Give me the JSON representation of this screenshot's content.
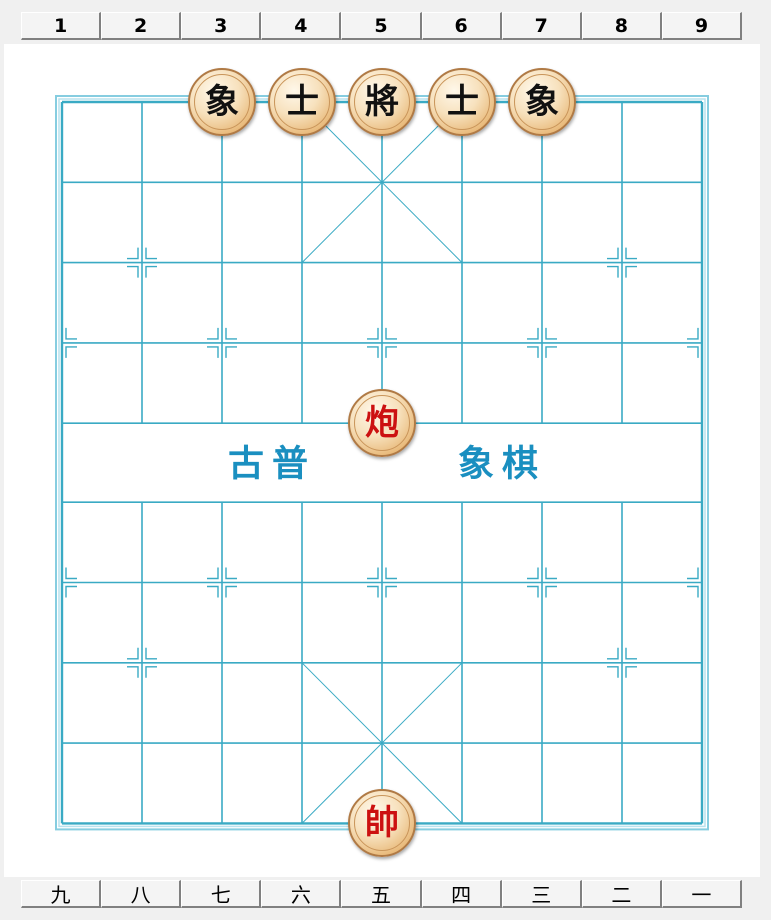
{
  "top_files": [
    "1",
    "2",
    "3",
    "4",
    "5",
    "6",
    "7",
    "8",
    "9"
  ],
  "bottom_files": [
    "九",
    "八",
    "七",
    "六",
    "五",
    "四",
    "三",
    "二",
    "一"
  ],
  "river": {
    "left_text": "古普",
    "right_text": "象棋"
  },
  "colors": {
    "grid_line": "#3aaac4",
    "river_text": "#1a8fc0",
    "red_piece_text": "#cc1111",
    "black_piece_text": "#111111"
  },
  "pieces": [
    {
      "name": "black-elephant-left",
      "label": "象",
      "side": "black",
      "file": 3,
      "rank": 0
    },
    {
      "name": "black-advisor-left",
      "label": "士",
      "side": "black",
      "file": 4,
      "rank": 0
    },
    {
      "name": "black-general",
      "label": "將",
      "side": "black",
      "file": 5,
      "rank": 0
    },
    {
      "name": "black-advisor-right",
      "label": "士",
      "side": "black",
      "file": 6,
      "rank": 0
    },
    {
      "name": "black-elephant-right",
      "label": "象",
      "side": "black",
      "file": 7,
      "rank": 0
    },
    {
      "name": "red-cannon",
      "label": "炮",
      "side": "red",
      "file": 5,
      "rank": 4
    },
    {
      "name": "red-marshal",
      "label": "帥",
      "side": "red",
      "file": 5,
      "rank": 9
    }
  ]
}
